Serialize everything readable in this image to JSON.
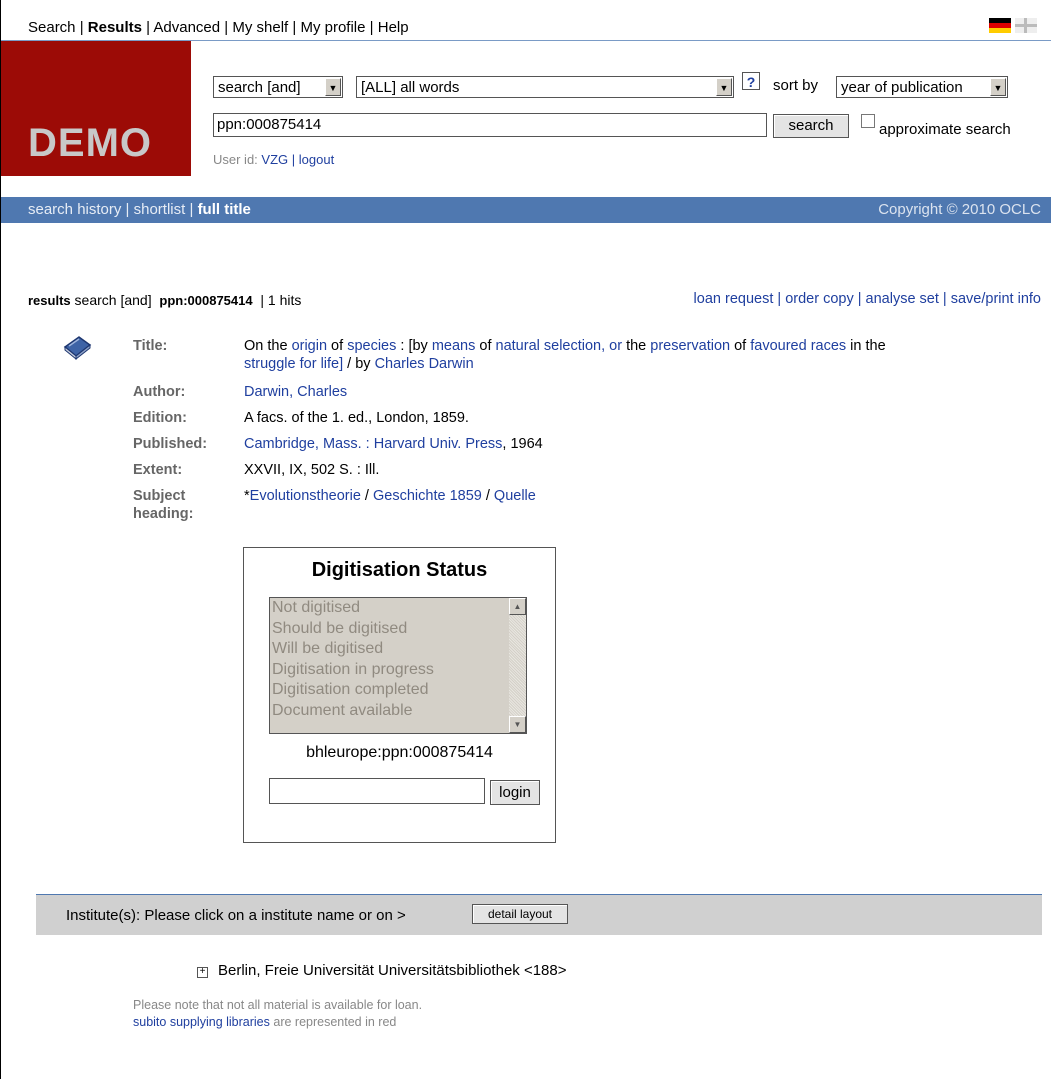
{
  "topnav": {
    "items": [
      {
        "label": "Search",
        "active": false
      },
      {
        "label": "Results",
        "active": true
      },
      {
        "label": "Advanced",
        "active": false
      },
      {
        "label": "My shelf",
        "active": false
      },
      {
        "label": "My profile",
        "active": false
      },
      {
        "label": "Help",
        "active": false
      }
    ],
    "sep": "|"
  },
  "header": {
    "logo": "DEMO",
    "search_mode": "search [and]",
    "field": "[ALL] all words",
    "help_icon": "?",
    "sort_label": "sort by",
    "sort_value": "year of publication",
    "query": "ppn:000875414",
    "search_button": "search",
    "approx_label": "approximate search",
    "user_label": "User id:",
    "user_id": "VZG",
    "logout": "logout"
  },
  "subnav": {
    "history": "search history",
    "shortlist": "shortlist",
    "full_title": "full title",
    "copyright": "Copyright © 2010 OCLC"
  },
  "results": {
    "label": "results",
    "mode": "search [and]",
    "query": "ppn:000875414",
    "hits": "| 1 hits",
    "actions": [
      "loan request",
      "order copy",
      "analyse set",
      "save/print info"
    ]
  },
  "record": {
    "labels": {
      "title": "Title:",
      "author": "Author:",
      "edition": "Edition:",
      "published": "Published:",
      "extent": "Extent:",
      "subject1": "Subject",
      "subject2": "heading:"
    },
    "title": {
      "t1": "On the ",
      "l1": "origin",
      "t2": " of ",
      "l2": "species",
      "t3": " : [by ",
      "l3": "means",
      "t4": " of ",
      "l4": "natural selection, or",
      "t5": " the ",
      "l5": "preservation",
      "t6": " of ",
      "l6": "favoured races",
      "t7": " in the",
      "l7": "struggle for life]",
      "t8": " / by ",
      "l8": "Charles Darwin"
    },
    "author": "Darwin, Charles",
    "edition": "A facs. of the 1. ed., London, 1859.",
    "published_link": "Cambridge, Mass. : Harvard Univ. Press",
    "published_year": ", 1964",
    "extent": "XXVII, IX, 502 S. : Ill.",
    "subject": {
      "star": "*",
      "s1": "Evolutionstheorie",
      "sep1": " / ",
      "s2": "Geschichte 1859",
      "sep2": " / ",
      "s3": "Quelle"
    }
  },
  "digitisation": {
    "title": "Digitisation Status",
    "options": [
      "Not digitised",
      "Should be digitised",
      "Will be digitised",
      "Digitisation in progress",
      "Digitisation completed",
      "Document available"
    ],
    "id": "bhleurope:ppn:000875414",
    "login_button": "login"
  },
  "institutes": {
    "prompt": "Institute(s): Please click on a institute name or on >",
    "detail_button": "detail layout",
    "plus": "+",
    "item": "Berlin, Freie Universität Universitätsbibliothek <188>",
    "note1": "Please note that not all material is available for loan.",
    "note2_link": "subito supplying libraries",
    "note2_rest": " are represented in red"
  },
  "colors": {
    "logo_bg": "#9c0b06",
    "bar_bg": "#4f78b0",
    "link": "#1f3f9f"
  }
}
